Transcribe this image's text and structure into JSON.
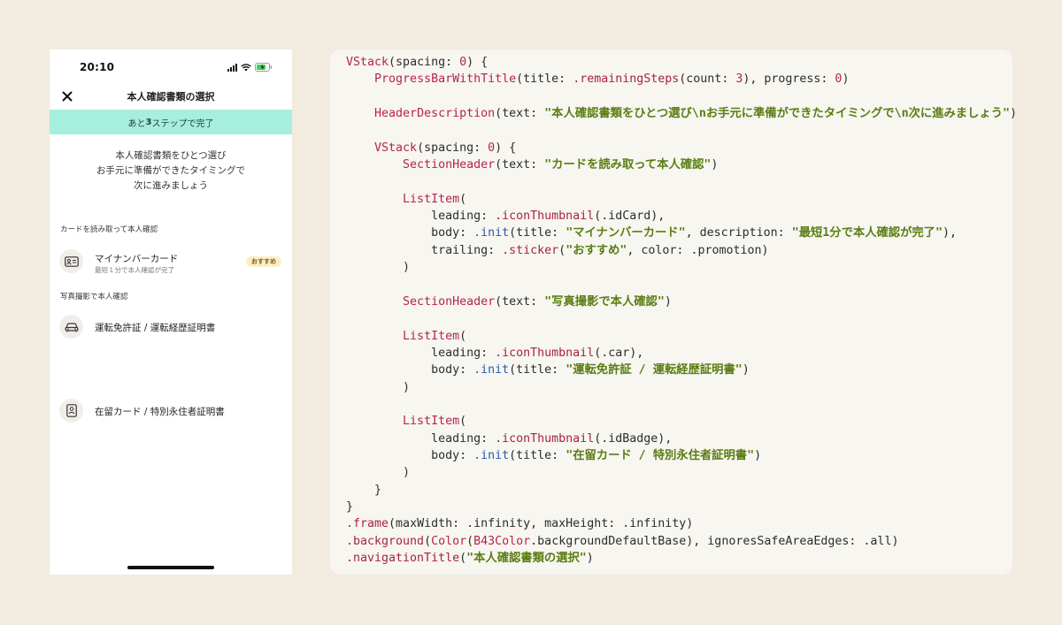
{
  "phone": {
    "status": {
      "time": "20:10"
    },
    "nav": {
      "title": "本人確認書類の選択"
    },
    "progress": {
      "prefix": "あと",
      "count": "3",
      "suffix": "ステップで完了",
      "value": 0
    },
    "header_description": "本人確認書類をひとつ選び\nお手元に準備ができたタイミングで\n次に進みましょう",
    "sections": [
      {
        "header": "カードを読み取って本人確認",
        "items": [
          {
            "icon": "id-card-icon",
            "title": "マイナンバーカード",
            "description": "最短１分で本人確認が完了",
            "sticker": "おすすめ"
          }
        ]
      },
      {
        "header": "写真撮影で本人確認",
        "items": [
          {
            "icon": "car-icon",
            "title": "運転免許証 / 運転経歴証明書"
          },
          {
            "icon": "id-badge-icon",
            "title": "在留カード / 特別永住者証明書"
          }
        ]
      }
    ]
  },
  "code_lines": [
    [
      [
        "fn",
        "VStack"
      ],
      [
        "p",
        "(spacing: "
      ],
      [
        "fn",
        "0"
      ],
      [
        "p",
        ") {"
      ]
    ],
    [
      [
        "p",
        "    "
      ],
      [
        "fn",
        "ProgressBarWithTitle"
      ],
      [
        "p",
        "(title: "
      ],
      [
        "dot",
        ".remainingSteps"
      ],
      [
        "p",
        "(count: "
      ],
      [
        "fn",
        "3"
      ],
      [
        "p",
        "), progress: "
      ],
      [
        "fn",
        "0"
      ],
      [
        "p",
        ")"
      ]
    ],
    [
      [
        "p",
        ""
      ]
    ],
    [
      [
        "p",
        "    "
      ],
      [
        "fn",
        "HeaderDescription"
      ],
      [
        "p",
        "(text: "
      ],
      [
        "str",
        "\"本人確認書類をひとつ選び\\nお手元に準備ができたタイミングで\\n次に進みましょう\""
      ],
      [
        "p",
        ")"
      ]
    ],
    [
      [
        "p",
        ""
      ]
    ],
    [
      [
        "p",
        "    "
      ],
      [
        "fn",
        "VStack"
      ],
      [
        "p",
        "(spacing: "
      ],
      [
        "fn",
        "0"
      ],
      [
        "p",
        ") {"
      ]
    ],
    [
      [
        "p",
        "        "
      ],
      [
        "fn",
        "SectionHeader"
      ],
      [
        "p",
        "(text: "
      ],
      [
        "str",
        "\"カードを読み取って本人確認\""
      ],
      [
        "p",
        ")"
      ]
    ],
    [
      [
        "p",
        ""
      ]
    ],
    [
      [
        "p",
        "        "
      ],
      [
        "fn",
        "ListItem"
      ],
      [
        "p",
        "("
      ]
    ],
    [
      [
        "p",
        "            leading: "
      ],
      [
        "dot",
        ".iconThumbnail"
      ],
      [
        "p",
        "(.idCard),"
      ]
    ],
    [
      [
        "p",
        "            body: "
      ],
      [
        "kw",
        ".init"
      ],
      [
        "p",
        "(title: "
      ],
      [
        "str",
        "\"マイナンバーカード\""
      ],
      [
        "p",
        ", description: "
      ],
      [
        "str",
        "\"最短1分で本人確認が完了\""
      ],
      [
        "p",
        "),"
      ]
    ],
    [
      [
        "p",
        "            trailing: "
      ],
      [
        "dot",
        ".sticker"
      ],
      [
        "p",
        "("
      ],
      [
        "str",
        "\"おすすめ\""
      ],
      [
        "p",
        ", color: .promotion)"
      ]
    ],
    [
      [
        "p",
        "        )"
      ]
    ],
    [
      [
        "p",
        ""
      ]
    ],
    [
      [
        "p",
        "        "
      ],
      [
        "fn",
        "SectionHeader"
      ],
      [
        "p",
        "(text: "
      ],
      [
        "str",
        "\"写真撮影で本人確認\""
      ],
      [
        "p",
        ")"
      ]
    ],
    [
      [
        "p",
        ""
      ]
    ],
    [
      [
        "p",
        "        "
      ],
      [
        "fn",
        "ListItem"
      ],
      [
        "p",
        "("
      ]
    ],
    [
      [
        "p",
        "            leading: "
      ],
      [
        "dot",
        ".iconThumbnail"
      ],
      [
        "p",
        "(.car),"
      ]
    ],
    [
      [
        "p",
        "            body: "
      ],
      [
        "kw",
        ".init"
      ],
      [
        "p",
        "(title: "
      ],
      [
        "str",
        "\"運転免許証 / 運転経歴証明書\""
      ],
      [
        "p",
        ")"
      ]
    ],
    [
      [
        "p",
        "        )"
      ]
    ],
    [
      [
        "p",
        ""
      ]
    ],
    [
      [
        "p",
        "        "
      ],
      [
        "fn",
        "ListItem"
      ],
      [
        "p",
        "("
      ]
    ],
    [
      [
        "p",
        "            leading: "
      ],
      [
        "dot",
        ".iconThumbnail"
      ],
      [
        "p",
        "(.idBadge),"
      ]
    ],
    [
      [
        "p",
        "            body: "
      ],
      [
        "kw",
        ".init"
      ],
      [
        "p",
        "(title: "
      ],
      [
        "str",
        "\"在留カード / 特別永住者証明書\""
      ],
      [
        "p",
        ")"
      ]
    ],
    [
      [
        "p",
        "        )"
      ]
    ],
    [
      [
        "p",
        "    }"
      ]
    ],
    [
      [
        "p",
        "}"
      ]
    ],
    [
      [
        "dot",
        ".frame"
      ],
      [
        "p",
        "(maxWidth: .infinity, maxHeight: .infinity)"
      ]
    ],
    [
      [
        "dot",
        ".background"
      ],
      [
        "p",
        "("
      ],
      [
        "fn",
        "Color"
      ],
      [
        "p",
        "("
      ],
      [
        "fn",
        "B43Color"
      ],
      [
        "p",
        ".backgroundDefaultBase), ignoresSafeAreaEdges: .all)"
      ]
    ],
    [
      [
        "dot",
        ".navigationTitle"
      ],
      [
        "p",
        "("
      ],
      [
        "str",
        "\"本人確認書類の選択\""
      ],
      [
        "p",
        ")"
      ]
    ]
  ]
}
